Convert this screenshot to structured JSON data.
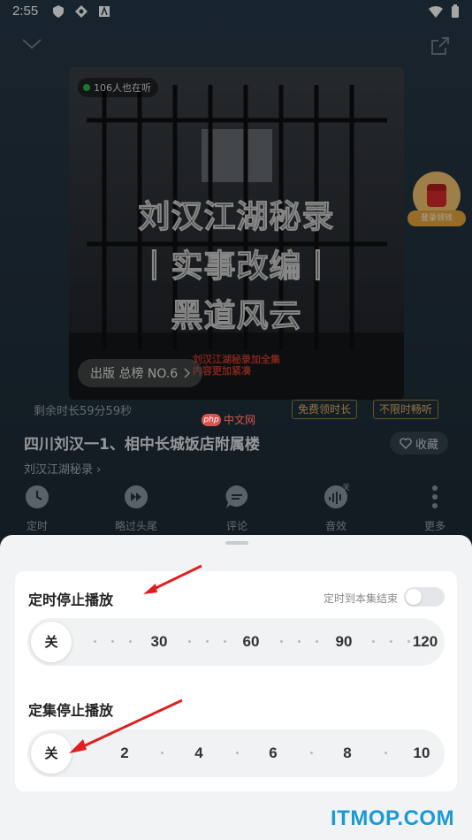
{
  "status_bar": {
    "time": "2:55"
  },
  "player": {
    "listeners": "106人也在听",
    "cover_title_lines": [
      "刘汉江湖秘录",
      "丨实事改编丨",
      "黑道风云"
    ],
    "cover_sub_lines": [
      "刘汉江湖秘录加全集",
      "内容更加紧凑"
    ],
    "rank": "出版 总榜 NO.6",
    "coupon_label": "登录领钱",
    "remaining": "剩余时长59分59秒",
    "free_btn": "免费领时长",
    "vip_btn": "不限时畅听",
    "episode_title": "四川刘汉一1、相中长城饭店附属楼",
    "favorite": "收藏",
    "album_link": "刘汉江湖秘录",
    "actions": [
      {
        "label": "定时",
        "icon": "clock-icon"
      },
      {
        "label": "略过头尾",
        "icon": "skip-icon"
      },
      {
        "label": "评论",
        "icon": "comment-icon"
      },
      {
        "label": "音效",
        "icon": "sound-effect-icon",
        "badge": "关"
      },
      {
        "label": "更多",
        "icon": "more-icon"
      }
    ]
  },
  "sheet": {
    "timer": {
      "title": "定时停止播放",
      "toggle_label": "定时到本集结束",
      "toggle_on": false,
      "selected": "关",
      "stops": [
        "30",
        "60",
        "90",
        "120"
      ]
    },
    "episodes": {
      "title": "定集停止播放",
      "selected": "关",
      "stops": [
        "2",
        "4",
        "6",
        "8",
        "10"
      ]
    }
  },
  "watermark": {
    "php": "php",
    "site": "中文网",
    "brand": "ITMOP.COM"
  },
  "colors": {
    "sheet_bg": "#f2f3f5",
    "arrow": "#e02020",
    "brand": "#1a9ad6"
  }
}
